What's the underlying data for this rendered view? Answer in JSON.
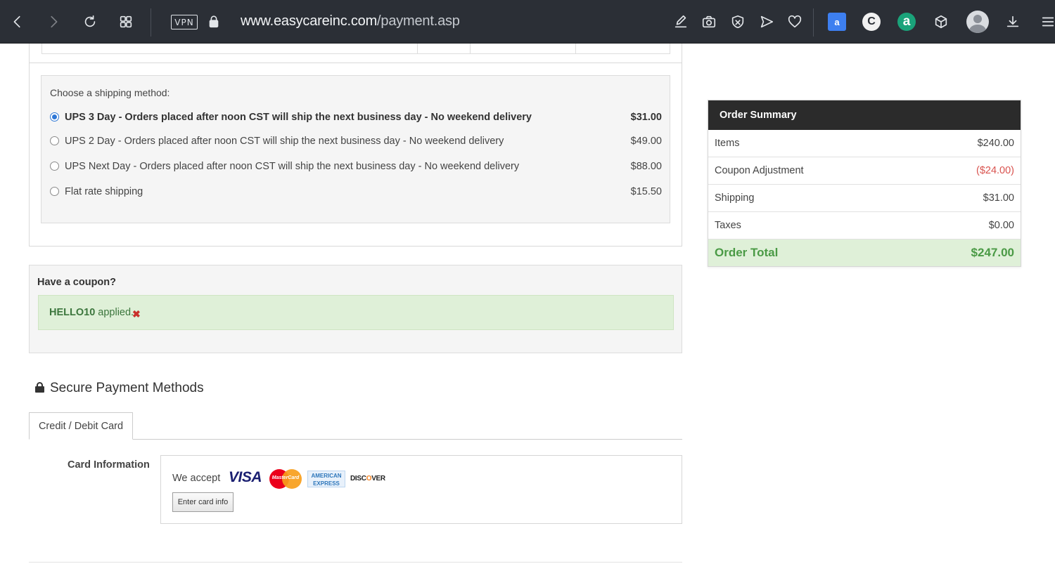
{
  "browser": {
    "url_host": "www.easycareinc.com",
    "url_path": "/payment.asp",
    "vpn_label": "VPN",
    "icons": [
      "back-icon",
      "forward-icon",
      "reload-icon",
      "tab-grid-icon",
      "lock-icon",
      "edit-icon",
      "camera-icon",
      "block-icon",
      "send-icon",
      "heart-icon",
      "translate-icon",
      "c-extension-icon",
      "a-extension-icon",
      "cube-icon",
      "avatar-icon",
      "download-icon",
      "menu-icon"
    ],
    "ext_translate": "a",
    "ext_c": "C",
    "ext_a": "a"
  },
  "shipping": {
    "label": "Choose a shipping method:",
    "options": [
      {
        "label": "UPS 3 Day - Orders placed after noon CST will ship the next business day - No weekend delivery",
        "price": "$31.00",
        "selected": true
      },
      {
        "label": "UPS 2 Day - Orders placed after noon CST will ship the next business day - No weekend delivery",
        "price": "$49.00",
        "selected": false
      },
      {
        "label": "UPS Next Day - Orders placed after noon CST will ship the next business day - No weekend delivery",
        "price": "$88.00",
        "selected": false
      },
      {
        "label": "Flat rate shipping",
        "price": "$15.50",
        "selected": false
      }
    ]
  },
  "coupon": {
    "title": "Have a coupon?",
    "code": "HELLO10",
    "applied_text": " applied.",
    "remove_symbol": "✖"
  },
  "payment": {
    "title": "Secure Payment Methods",
    "tab_label": "Credit / Debit Card",
    "card_info_label": "Card Information",
    "we_accept": "We accept",
    "visa": "VISA",
    "mastercard": "MasterCard",
    "amex_line1": "AMERICAN",
    "amex_line2": "EXPRESS",
    "discover_pre": "DISC",
    "discover_o": "O",
    "discover_post": "VER",
    "enter_card_button": "Enter card info"
  },
  "summary": {
    "title": "Order Summary",
    "rows": [
      {
        "label": "Items",
        "value": "$240.00"
      },
      {
        "label": "Coupon Adjustment",
        "value": "($24.00)"
      },
      {
        "label": "Shipping",
        "value": "$31.00"
      },
      {
        "label": "Taxes",
        "value": "$0.00"
      }
    ],
    "total_label": "Order Total",
    "total_value": "$247.00"
  },
  "colors": {
    "browser_bar": "#2b2f36",
    "summary_header": "#2b2b2b",
    "success_bg": "#dff0d8",
    "success_text": "#3c763d",
    "total_text": "#4a9a45",
    "negative": "#d9534f",
    "radio_selected": "#2d77d6"
  }
}
